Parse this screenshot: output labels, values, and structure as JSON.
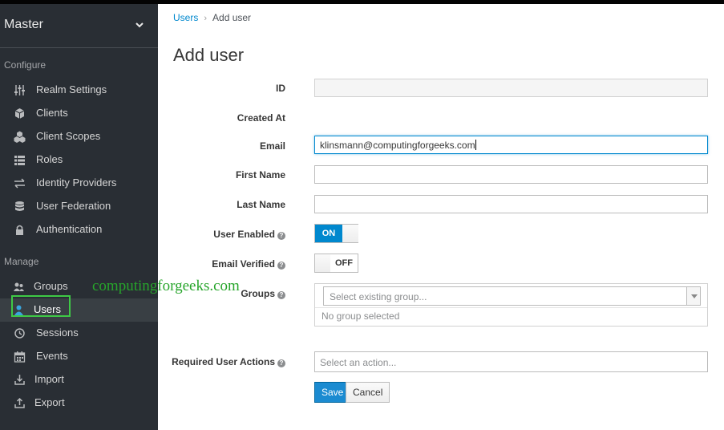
{
  "sidebar": {
    "realm": "Master",
    "configure_heading": "Configure",
    "configure_items": [
      {
        "label": "Realm Settings",
        "icon": "sliders-icon"
      },
      {
        "label": "Clients",
        "icon": "cube-icon"
      },
      {
        "label": "Client Scopes",
        "icon": "cubes-icon"
      },
      {
        "label": "Roles",
        "icon": "list-icon"
      },
      {
        "label": "Identity Providers",
        "icon": "exchange-icon"
      },
      {
        "label": "User Federation",
        "icon": "database-icon"
      },
      {
        "label": "Authentication",
        "icon": "lock-icon"
      }
    ],
    "manage_heading": "Manage",
    "manage_items": [
      {
        "label": "Groups",
        "icon": "users-icon"
      },
      {
        "label": "Users",
        "icon": "user-icon",
        "active": true
      },
      {
        "label": "Sessions",
        "icon": "clock-icon"
      },
      {
        "label": "Events",
        "icon": "calendar-icon"
      },
      {
        "label": "Import",
        "icon": "import-icon"
      },
      {
        "label": "Export",
        "icon": "export-icon"
      }
    ]
  },
  "breadcrumb": {
    "parent": "Users",
    "separator": "›",
    "current": "Add user"
  },
  "page_title": "Add user",
  "form": {
    "id_label": "ID",
    "id_value": "",
    "created_at_label": "Created At",
    "email_label": "Email",
    "email_value": "klinsmann@computingforgeeks.com",
    "first_name_label": "First Name",
    "first_name_value": "",
    "last_name_label": "Last Name",
    "last_name_value": "",
    "user_enabled_label": "User Enabled",
    "user_enabled_state": "ON",
    "email_verified_label": "Email Verified",
    "email_verified_state": "OFF",
    "groups_label": "Groups",
    "groups_placeholder": "Select existing group...",
    "groups_empty": "No group selected",
    "required_actions_label": "Required User Actions",
    "required_actions_placeholder": "Select an action...",
    "help_glyph": "?"
  },
  "buttons": {
    "save": "Save",
    "cancel": "Cancel"
  },
  "watermark": "computingforgeeks.com",
  "colors": {
    "accent": "#0088ce",
    "sidebar": "#292e34",
    "highlight": "#3ec946"
  }
}
